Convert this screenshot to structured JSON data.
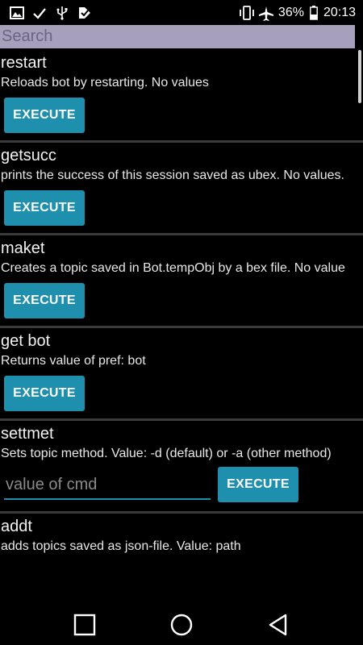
{
  "status": {
    "battery": "36%",
    "time": "20:13"
  },
  "search": {
    "placeholder": "Search"
  },
  "items": [
    {
      "name": "restart",
      "desc": "Reloads bot by restarting. No values",
      "button": "EXECUTE"
    },
    {
      "name": "getsucc",
      "desc": "prints the success of this session saved as ubex. No values.",
      "button": "EXECUTE"
    },
    {
      "name": "maket",
      "desc": "Creates a topic saved in Bot.tempObj by a bex file. No value",
      "button": "EXECUTE"
    },
    {
      "name": "get bot",
      "desc": "Returns value of pref: bot",
      "button": "EXECUTE"
    },
    {
      "name": "settmet",
      "desc": "Sets topic method. Value: -d (default) or -a (other method)",
      "button": "EXECUTE",
      "input_placeholder": "value of cmd"
    },
    {
      "name": "addt",
      "desc": "adds topics saved as json-file. Value: path"
    }
  ],
  "icons": {
    "status_left": [
      "image-icon",
      "check-icon",
      "usb-icon",
      "download-done-icon"
    ],
    "status_right": [
      "vibrate-icon",
      "airplane-icon",
      "battery-icon"
    ],
    "nav": [
      "recents-icon",
      "home-icon",
      "back-icon"
    ]
  }
}
